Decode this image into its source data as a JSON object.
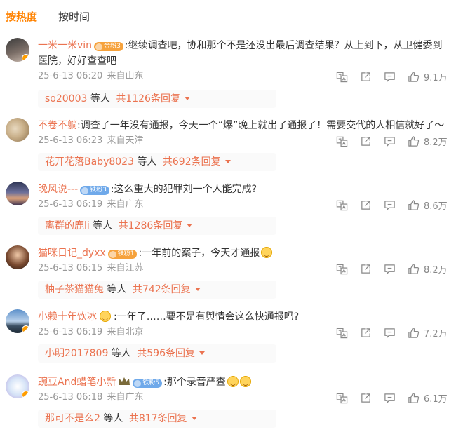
{
  "tabs": [
    {
      "label": "按热度",
      "active": true
    },
    {
      "label": "按时间",
      "active": false
    }
  ],
  "comments": [
    {
      "user": "一米一米vin",
      "badge": "金粉3",
      "text": ":继续调查吧，协和那个不是还没出最后调查结果？从上到下，从卫健委到医院，好好查查吧",
      "time": "25-6-13 06:20",
      "location": "来自山东",
      "likes": "9.1万",
      "reply_user": "so20003",
      "reply_mid": "等人",
      "reply_count": "共1126条回复"
    },
    {
      "user": "不卷不躺",
      "badge": "",
      "text": ":调查了一年没有通报，今天一个“爆”晚上就出了通报了！需要交代的人相信就好了～",
      "time": "25-6-13 06:23",
      "location": "来自天津",
      "likes": "8.2万",
      "reply_user": "花开花落Baby8023",
      "reply_mid": "等人",
      "reply_count": "共692条回复"
    },
    {
      "user": "晚风说---",
      "badge": "铁粉3",
      "text": ":这么重大的犯罪刘一个人能完成?",
      "time": "25-6-13 06:19",
      "location": "来自广东",
      "likes": "8.6万",
      "reply_user": "离群的鹿li",
      "reply_mid": "等人",
      "reply_count": "共1286条回复"
    },
    {
      "user": "猫咪日记_dyxx",
      "badge": "铁粉1",
      "text": ":一年前的案子，今天才通报",
      "time": "25-6-13 06:15",
      "location": "来自江苏",
      "likes": "8.2万",
      "reply_user": "柚子茶猫猫兔",
      "reply_mid": "等人",
      "reply_count": "共742条回复"
    },
    {
      "user": "小赖十年饮冰",
      "badge": "",
      "text": ":一年了……要不是有舆情会这么快通报吗?",
      "time": "25-6-13 06:19",
      "location": "来自北京",
      "likes": "7.2万",
      "reply_user": "小明2017809",
      "reply_mid": "等人",
      "reply_count": "共596条回复"
    },
    {
      "user": "豌豆And蜡笔小新",
      "badge": "铁粉5",
      "text": ":那个录音严查",
      "time": "25-6-13 06:18",
      "location": "来自广东",
      "likes": "6.1万",
      "reply_user": "那可不是么2",
      "reply_mid": "等人",
      "reply_count": "共817条回复"
    }
  ],
  "colors": {
    "accent": "#ff8200",
    "username": "#eb7350",
    "meta": "#999999"
  },
  "icons": [
    "translate-icon",
    "share-icon",
    "comment-icon",
    "like-icon"
  ]
}
